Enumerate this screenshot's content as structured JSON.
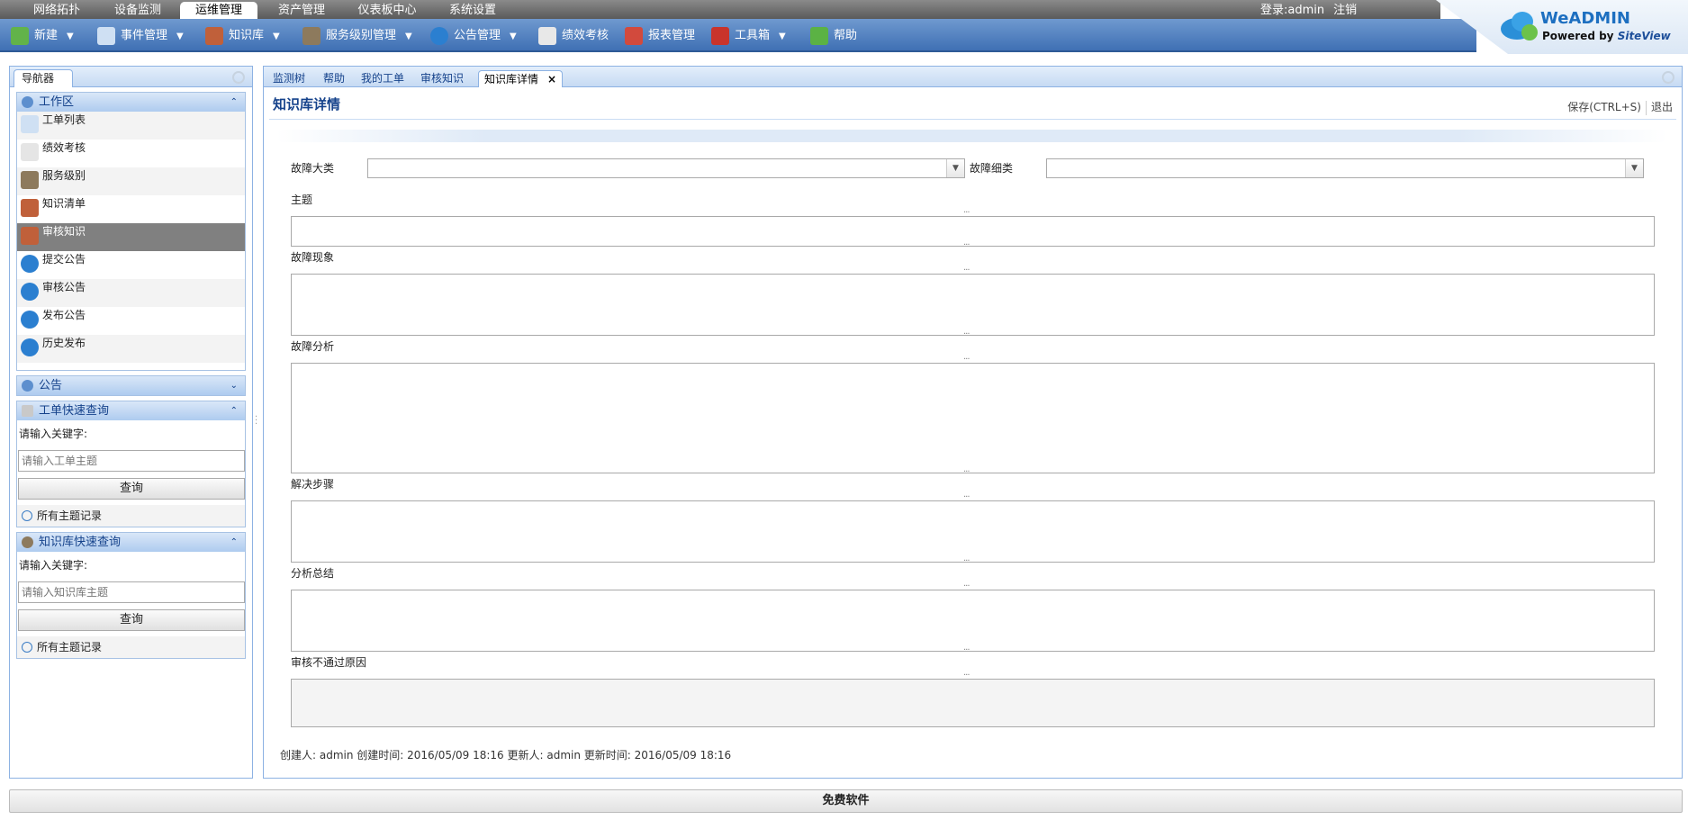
{
  "nav": {
    "tabs": [
      "网络拓扑",
      "设备监测",
      "运维管理",
      "资产管理",
      "仪表板中心",
      "系统设置"
    ],
    "active_index": 2
  },
  "login": {
    "user": "登录:admin",
    "logout": "注销"
  },
  "toolbar": [
    {
      "label": "新建",
      "icon": "new-icon",
      "dropdown": true
    },
    {
      "label": "事件管理",
      "icon": "event-icon",
      "dropdown": true
    },
    {
      "label": "知识库",
      "icon": "books-icon",
      "dropdown": true
    },
    {
      "label": "服务级别管理",
      "icon": "service-level-icon",
      "dropdown": true
    },
    {
      "label": "公告管理",
      "icon": "info-icon",
      "dropdown": true
    },
    {
      "label": "绩效考核",
      "icon": "performance-icon",
      "dropdown": false
    },
    {
      "label": "报表管理",
      "icon": "report-icon",
      "dropdown": false
    },
    {
      "label": "工具箱",
      "icon": "toolbox-icon",
      "dropdown": true
    },
    {
      "label": "帮助",
      "icon": "help-icon",
      "dropdown": false
    }
  ],
  "logo": {
    "name": "WeADMIN",
    "powered": "Powered by",
    "brand": "SiteView"
  },
  "sidebar": {
    "tab": "导航器",
    "workarea": {
      "title": "工作区",
      "items": [
        {
          "label": "工单列表",
          "icon": "ticket-list-icon"
        },
        {
          "label": "绩效考核",
          "icon": "performance-icon"
        },
        {
          "label": "服务级别",
          "icon": "service-level-icon"
        },
        {
          "label": "知识清单",
          "icon": "knowledge-list-icon"
        },
        {
          "label": "审核知识",
          "icon": "review-knowledge-icon"
        },
        {
          "label": "提交公告",
          "icon": "submit-notice-icon"
        },
        {
          "label": "审核公告",
          "icon": "review-notice-icon"
        },
        {
          "label": "发布公告",
          "icon": "publish-notice-icon"
        },
        {
          "label": "历史发布",
          "icon": "history-icon"
        }
      ],
      "selected_index": 4
    },
    "notice": {
      "title": "公告"
    },
    "ticket_query": {
      "title": "工单快速查询",
      "prompt": "请输入关键字:",
      "placeholder": "请输入工单主题",
      "button": "查询",
      "all": "所有主题记录"
    },
    "kb_query": {
      "title": "知识库快速查询",
      "prompt": "请输入关键字:",
      "placeholder": "请输入知识库主题",
      "button": "查询",
      "all": "所有主题记录"
    }
  },
  "main": {
    "tabs": [
      "监测树",
      "帮助",
      "我的工单",
      "审核知识",
      "知识库详情"
    ],
    "active_index": 4,
    "close": "×",
    "title": "知识库详情",
    "save": "保存(CTRL+S)",
    "exit": "退出",
    "form": {
      "category_label": "故障大类",
      "category_value": "",
      "subcategory_label": "故障细类",
      "subcategory_value": "",
      "subject_label": "主题",
      "phenomenon_label": "故障现象",
      "analysis_label": "故障分析",
      "steps_label": "解决步骤",
      "summary_label": "分析总结",
      "reject_label": "审核不通过原因"
    },
    "footer": "创建人: admin 创建时间: 2016/05/09 18:16 更新人: admin 更新时间: 2016/05/09 18:16"
  },
  "status": "免费软件",
  "colors": {
    "toolbar": "#4f80c2",
    "nav": "#6b6b6b",
    "accent": "#15428b",
    "selected": "#808080"
  }
}
